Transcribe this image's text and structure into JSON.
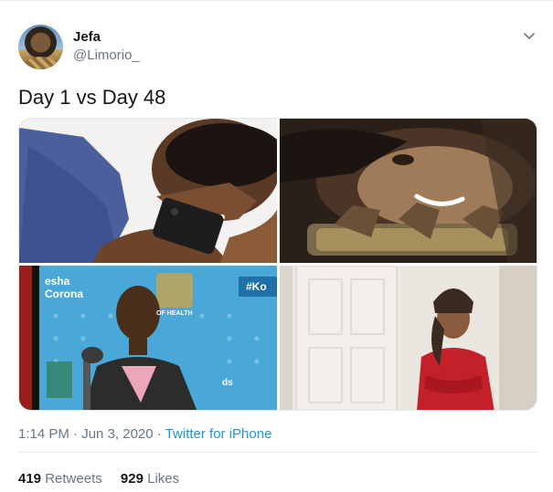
{
  "author": {
    "display_name": "Jefa",
    "handle": "@Limorio_"
  },
  "tweet": {
    "text": "Day 1 vs Day 48"
  },
  "photos": [
    {
      "label": "photo-1"
    },
    {
      "label": "photo-2"
    },
    {
      "label": "photo-3"
    },
    {
      "label": "photo-4"
    }
  ],
  "photo3": {
    "sign_left_top": "esha",
    "sign_left_bottom": "Corona",
    "sign_right": "#Ko",
    "sign_health": "OF HEALTH",
    "sign_ds": "ds"
  },
  "meta": {
    "time": "1:14 PM",
    "separator1": " · ",
    "date": "Jun 3, 2020",
    "separator2": " · ",
    "source": "Twitter for iPhone"
  },
  "stats": {
    "retweets_count": "419",
    "retweets_label": "Retweets",
    "likes_count": "929",
    "likes_label": "Likes"
  },
  "colors": {
    "link": "#1b95e0",
    "secondary_text": "#657786",
    "primary_text": "#14171a"
  }
}
